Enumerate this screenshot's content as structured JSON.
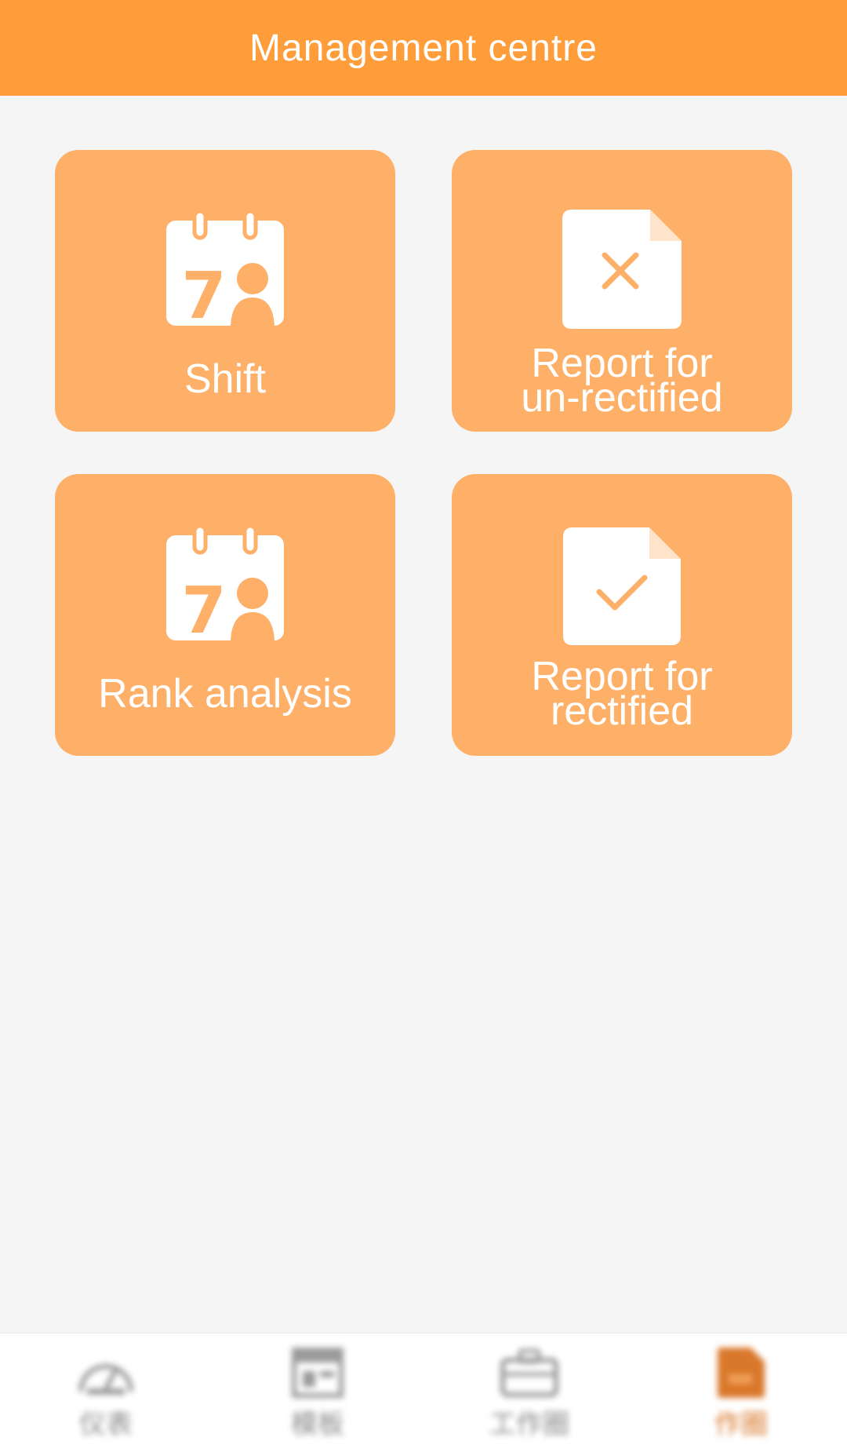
{
  "header": {
    "title": "Management centre"
  },
  "tiles": [
    {
      "label": "Shift",
      "icon": "calendar-person-icon"
    },
    {
      "label_lines": [
        "Report for",
        "un-rectified"
      ],
      "icon": "document-x-icon"
    },
    {
      "label": "Rank analysis",
      "icon": "calendar-person-icon"
    },
    {
      "label_lines": [
        "Report for",
        "rectified"
      ],
      "icon": "document-check-icon"
    }
  ],
  "tabbar": {
    "items": [
      {
        "label": "仪表",
        "icon": "gauge-icon",
        "active": false
      },
      {
        "label": "模板",
        "icon": "template-icon",
        "active": false
      },
      {
        "label": "工作圈",
        "icon": "briefcase-icon",
        "active": false
      },
      {
        "label": "作圈",
        "icon": "document-icon",
        "active": true
      }
    ]
  },
  "colors": {
    "header_bg": "#ff9d3a",
    "tile_bg": "#feb068",
    "page_bg": "#f5f5f5",
    "active_tab": "#d9782b"
  }
}
